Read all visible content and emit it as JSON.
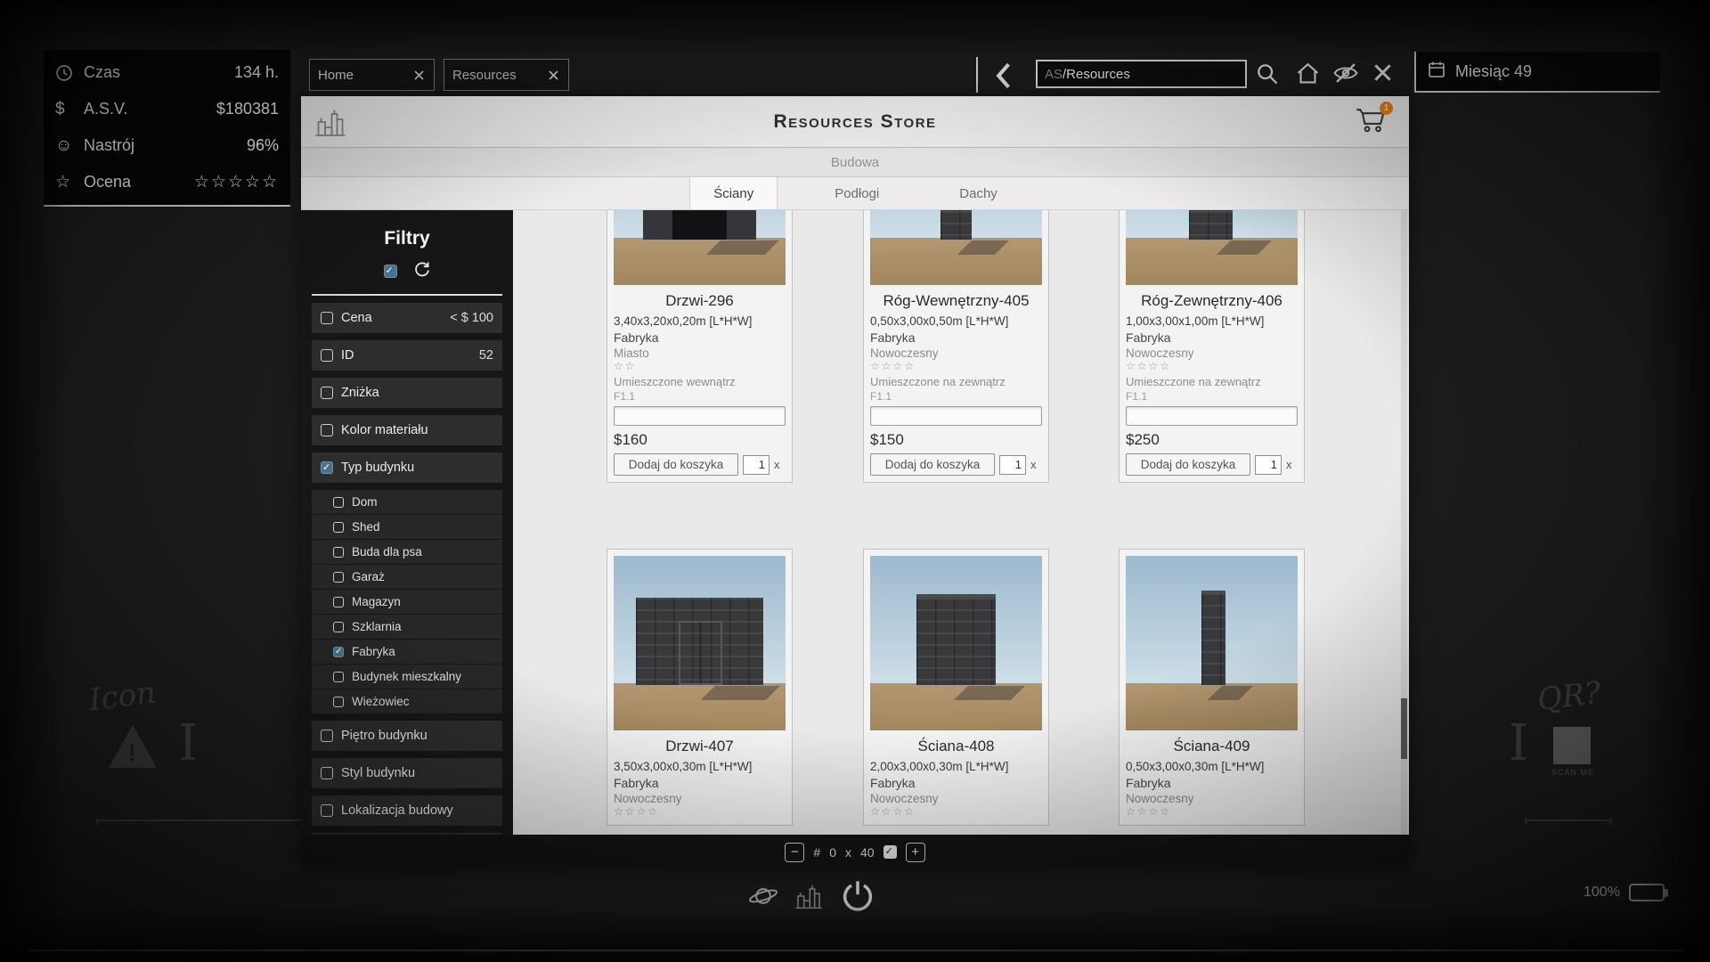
{
  "stats": {
    "rows": [
      {
        "label": "Czas",
        "value": "134 h."
      },
      {
        "label": "A.S.V.",
        "value": "$180381",
        "icon_glyph": "$"
      },
      {
        "label": "Nastrój",
        "value": "96%",
        "icon_glyph": "☺"
      },
      {
        "label": "Ocena",
        "value": "☆☆☆☆☆",
        "icon_glyph": "☆"
      }
    ]
  },
  "topbar": {
    "tabs": [
      {
        "label": "Home"
      },
      {
        "label": "Resources"
      }
    ],
    "address": {
      "typed": "AS",
      "completion": "/Resources"
    },
    "month": "Miesiąc 49"
  },
  "store": {
    "title": "Resources Store",
    "cart_badge": "1",
    "category": "Budowa",
    "tabs": [
      {
        "label": "Ściany"
      },
      {
        "label": "Podłogi"
      },
      {
        "label": "Dachy"
      }
    ],
    "filters": {
      "title": "Filtry",
      "top": [
        {
          "label": "Cena",
          "value": "< $ 100"
        },
        {
          "label": "ID",
          "value": "52"
        },
        {
          "label": "Zniżka",
          "value": ""
        },
        {
          "label": "Kolor materiału",
          "value": ""
        },
        {
          "label": "Typ budynku",
          "value": ""
        }
      ],
      "types": [
        {
          "label": "Dom"
        },
        {
          "label": "Shed"
        },
        {
          "label": "Buda dla psa"
        },
        {
          "label": "Garaż"
        },
        {
          "label": "Magazyn"
        },
        {
          "label": "Szklarnia"
        },
        {
          "label": "Fabryka"
        },
        {
          "label": "Budynek mieszkalny"
        },
        {
          "label": "Wieżowiec"
        }
      ],
      "more": [
        {
          "label": "Piętro budynku"
        },
        {
          "label": "Styl budynku"
        },
        {
          "label": "Lokalizacja budowy"
        }
      ]
    },
    "labels": {
      "add_to_cart": "Dodaj do koszyka",
      "qty_suffix": "x"
    },
    "products": [
      {
        "name": "Drzwi-296",
        "dims": "3,40x3,20x0,20m [L*H*W]",
        "maker": "Fabryka",
        "style": "Miasto",
        "stars": "☆☆",
        "placement": "Umieszczone wewnątrz",
        "floor": "F1.1",
        "price": "$160",
        "qty": "1"
      },
      {
        "name": "Róg-Wewnętrzny-405",
        "dims": "0,50x3,00x0,50m [L*H*W]",
        "maker": "Fabryka",
        "style": "Nowoczesny",
        "stars": "☆☆☆☆",
        "placement": "Umieszczone na zewnątrz",
        "floor": "F1.1",
        "price": "$150",
        "qty": "1"
      },
      {
        "name": "Róg-Zewnętrzny-406",
        "dims": "1,00x3,00x1,00m [L*H*W]",
        "maker": "Fabryka",
        "style": "Nowoczesny",
        "stars": "☆☆☆☆",
        "placement": "Umieszczone na zewnątrz",
        "floor": "F1.1",
        "price": "$250",
        "qty": "1"
      },
      {
        "name": "Drzwi-407",
        "dims": "3,50x3,00x0,30m [L*H*W]",
        "maker": "Fabryka",
        "style": "Nowoczesny",
        "stars": "☆☆☆☆"
      },
      {
        "name": "Ściana-408",
        "dims": "2,00x3,00x0,30m [L*H*W]",
        "maker": "Fabryka",
        "style": "Nowoczesny",
        "stars": "☆☆☆☆"
      },
      {
        "name": "Ściana-409",
        "dims": "0,50x3,00x0,30m [L*H*W]",
        "maker": "Fabryka",
        "style": "Nowoczesny",
        "stars": "☆☆☆☆"
      }
    ],
    "pagination": {
      "minus": "−",
      "hash": "#",
      "page": "0",
      "times": "x",
      "total": "40",
      "plus": "+"
    }
  },
  "system": {
    "battery": "100%"
  },
  "decor": {
    "left_caption": "Icon",
    "right_caption": "QR?",
    "qr_caption": "SCAN ME"
  }
}
